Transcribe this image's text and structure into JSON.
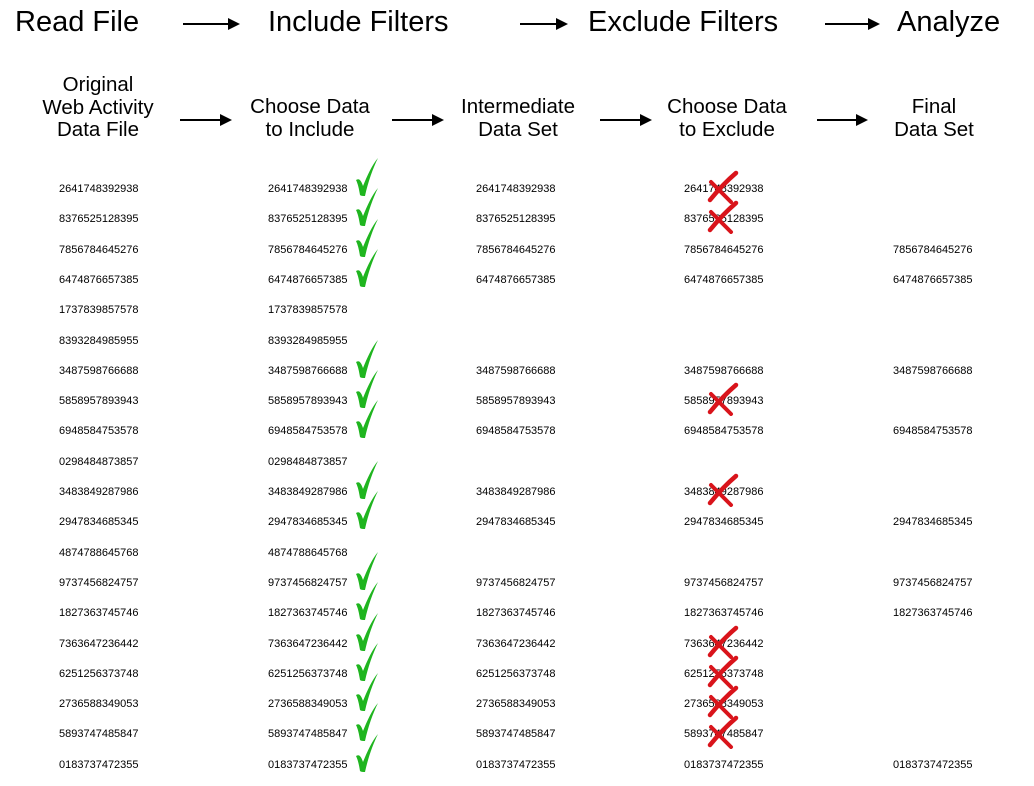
{
  "stages": [
    "Read File",
    "Include Filters",
    "Exclude Filters",
    "Analyze"
  ],
  "column_headers": [
    [
      "Original",
      "Web Activity",
      "Data File"
    ],
    [
      "Choose Data",
      "to Include"
    ],
    [
      "Intermediate",
      "Data Set"
    ],
    [
      "Choose Data",
      "to Exclude"
    ],
    [
      "Final",
      "Data Set"
    ]
  ],
  "columns": [
    [
      "2641748392938",
      "8376525128395",
      "7856784645276",
      "6474876657385",
      "1737839857578",
      "8393284985955",
      "3487598766688",
      "5858957893943",
      "6948584753578",
      "0298484873857",
      "3483849287986",
      "2947834685345",
      "4874788645768",
      "9737456824757",
      "1827363745746",
      "7363647236442",
      "6251256373748",
      "2736588349053",
      "5893747485847",
      "0183737472355"
    ],
    [
      "2641748392938",
      "8376525128395",
      "7856784645276",
      "6474876657385",
      "1737839857578",
      "8393284985955",
      "3487598766688",
      "5858957893943",
      "6948584753578",
      "0298484873857",
      "3483849287986",
      "2947834685345",
      "4874788645768",
      "9737456824757",
      "1827363745746",
      "7363647236442",
      "6251256373748",
      "2736588349053",
      "5893747485847",
      "0183737472355"
    ],
    [
      "2641748392938",
      "8376525128395",
      "7856784645276",
      "6474876657385",
      "",
      "",
      "3487598766688",
      "5858957893943",
      "6948584753578",
      "",
      "3483849287986",
      "2947834685345",
      "",
      "9737456824757",
      "1827363745746",
      "7363647236442",
      "6251256373748",
      "2736588349053",
      "5893747485847",
      "0183737472355"
    ],
    [
      "2641748392938",
      "8376525128395",
      "7856784645276",
      "6474876657385",
      "",
      "",
      "3487598766688",
      "5858957893943",
      "6948584753578",
      "",
      "3483849287986",
      "2947834685345",
      "",
      "9737456824757",
      "1827363745746",
      "7363647236442",
      "6251256373748",
      "2736588349053",
      "5893747485847",
      "0183737472355"
    ],
    [
      "",
      "",
      "7856784645276",
      "6474876657385",
      "",
      "",
      "3487598766688",
      "",
      "6948584753578",
      "",
      "",
      "2947834685345",
      "",
      "9737456824757",
      "1827363745746",
      "",
      "",
      "",
      "",
      "0183737472355"
    ]
  ],
  "include_checks": [
    true,
    true,
    true,
    true,
    false,
    false,
    true,
    true,
    true,
    false,
    true,
    true,
    false,
    true,
    true,
    true,
    true,
    true,
    true,
    true
  ],
  "exclude_crosses": [
    true,
    true,
    false,
    false,
    false,
    false,
    false,
    true,
    false,
    false,
    true,
    false,
    false,
    false,
    false,
    true,
    true,
    true,
    true,
    false
  ],
  "icons": {
    "include": "green-checkmark-icon",
    "exclude": "red-x-icon",
    "flow": "right-arrow-icon"
  },
  "colors": {
    "check": "#1fb51f",
    "cross": "#d9141b",
    "text": "#000000"
  }
}
